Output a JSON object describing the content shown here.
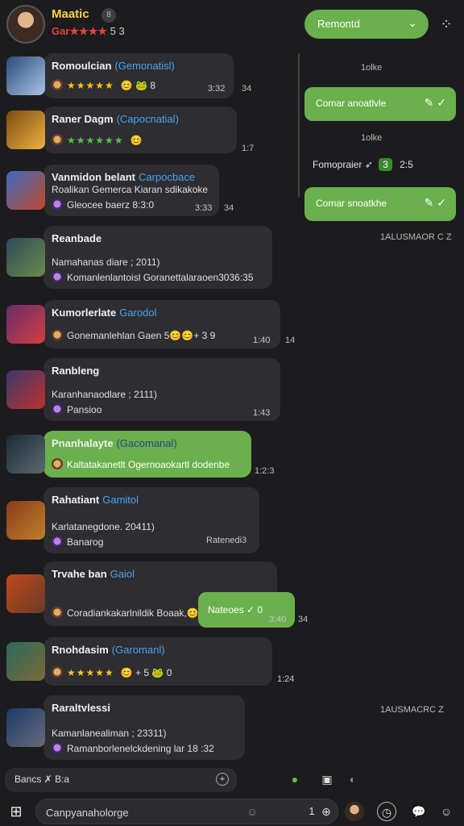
{
  "header": {
    "name": "Maatic",
    "badge": "8",
    "rating_prefix": "Gar★★★★",
    "rating_suffix": "5 3",
    "top_button": "Remontd",
    "top_button_icon": "chevron-down-icon"
  },
  "cards": [
    {
      "title": "Romoulcian",
      "tag": "(Gemonatisl)",
      "line1": "★★★★★",
      "line1_extra": "😊 🐸 8",
      "time": "3:32",
      "side_time": "34"
    },
    {
      "title": "Raner Dagm",
      "tag": "(Capocnatial)",
      "line1": "★★★★★★",
      "line1_extra": "😊",
      "time": "",
      "side_time": "1:7"
    },
    {
      "title": "Vanmidon belant",
      "tag": "Carpocbace",
      "line1": "Roalikan Gemerca Kiaran sdikakoke",
      "line2": "Gleocee baerz 8:3:0",
      "time": "3:33",
      "side_time": "34"
    },
    {
      "title": "Reanbade",
      "tag": "",
      "line1": "Namahanas diare ; 2011)",
      "line2": "Komanlenlantoisl Goranettalaraoen3036:35",
      "time": "",
      "side_time": ""
    },
    {
      "title": "Kumorlerlate",
      "tag": "Garodol",
      "line1": "Gonemanlehlan Gaen 5😊😊+ 3 9",
      "line2": "",
      "time": "1:40",
      "side_time": "14"
    },
    {
      "title": "Ranbleng",
      "tag": "",
      "line1": "Karanhanaodlare ; 2111)",
      "line2": "Pansioo",
      "time": "1:43",
      "side_time": ""
    },
    {
      "title": "Pnanhalayte",
      "tag": "(Gacomanal)",
      "line1": "Kaltatakanetlt Ogernoaokartl dodenbe",
      "line2": "",
      "time": "",
      "side_time": "1:2:3"
    },
    {
      "title": "Rahatiant",
      "tag": "Gamitol",
      "line1": "Karlatanegdone. 20411)",
      "line2": "Banarog",
      "time": "Ratenedi3",
      "side_time": ""
    },
    {
      "title": "Trvahe ban",
      "tag": "Gaiol",
      "line1": "Coradiankakarlnildik Boaak,😊",
      "line2": "",
      "time": "",
      "side_time": "34"
    },
    {
      "title": "Rnohdasim",
      "tag": "(Garomanl)",
      "line1": "★★★★★",
      "line1_extra": "😊 + 5 🐸 0",
      "time": "1:24",
      "side_time": ""
    },
    {
      "title": "Raraltvlessi",
      "tag": "",
      "line1": "Kamanlanealiman ; 23311)",
      "line2": "Ramanborlenelckdening lar 18 :32",
      "time": "",
      "side_time": "1AUSMACRC Z"
    }
  ],
  "right_pane": {
    "label_top": "1olke",
    "pill_1": "Comar anoatlvle",
    "label_mid": "1olke",
    "row": "Fomopraier",
    "row_chip": "3",
    "row_end": "2:5",
    "pill_2": "Comar snoatkhe",
    "label_low": "1ALUSMAOR C  Z",
    "popup": "Nateoes ✓ 0",
    "popup_time": "3:40"
  },
  "bottom": {
    "chip_label": "Bancs ✗ B:a",
    "input_placeholder": "Canpyanaholorge",
    "send_count": "1"
  },
  "colors": {
    "accent": "#6ab04c",
    "bg": "#1c1c1f",
    "card": "#2d2d32",
    "link": "#4aa3f0",
    "star": "#ffc21a"
  }
}
